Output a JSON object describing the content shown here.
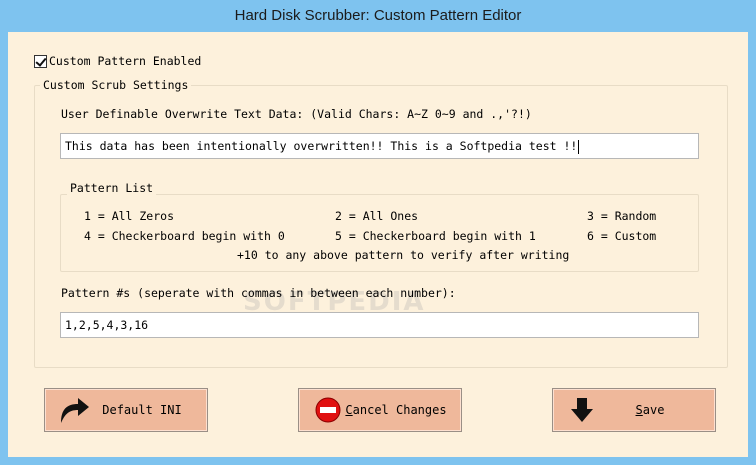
{
  "window": {
    "title": "Hard Disk Scrubber: Custom Pattern Editor"
  },
  "custom_pattern": {
    "enabled_label": "Custom Pattern Enabled",
    "enabled": true
  },
  "scrub_settings": {
    "legend": "Custom Scrub Settings",
    "overwrite_label": "User Definable Overwrite Text Data: (Valid Chars: A~Z 0~9 and .,'?!)",
    "overwrite_value": "This data has been intentionally overwritten!! This is a Softpedia test !!",
    "pattern_list": {
      "legend": "Pattern List",
      "items": [
        "1 = All Zeros",
        "2 = All Ones",
        "3 = Random",
        "4 = Checkerboard begin with 0",
        "5 = Checkerboard begin with 1",
        "6 = Custom"
      ],
      "note": "+10 to any above pattern to verify after writing"
    },
    "pattern_label": "Pattern #s (seperate with commas in between each number):",
    "pattern_value": "1,2,5,4,3,16"
  },
  "buttons": {
    "default_ini": {
      "label": "Default INI",
      "icon": "curved-arrow-icon"
    },
    "cancel": {
      "label_hot": "C",
      "label_rest": "ancel Changes",
      "icon": "no-entry-icon"
    },
    "save": {
      "label_hot": "S",
      "label_rest": "ave",
      "icon": "down-arrow-icon"
    }
  },
  "watermark": "SOFTPEDIA",
  "colors": {
    "client_bg": "#fdf1dc",
    "title_bg": "#7ec3ef",
    "button_bg": "#efb89b",
    "cancel_icon": "#e01010"
  }
}
